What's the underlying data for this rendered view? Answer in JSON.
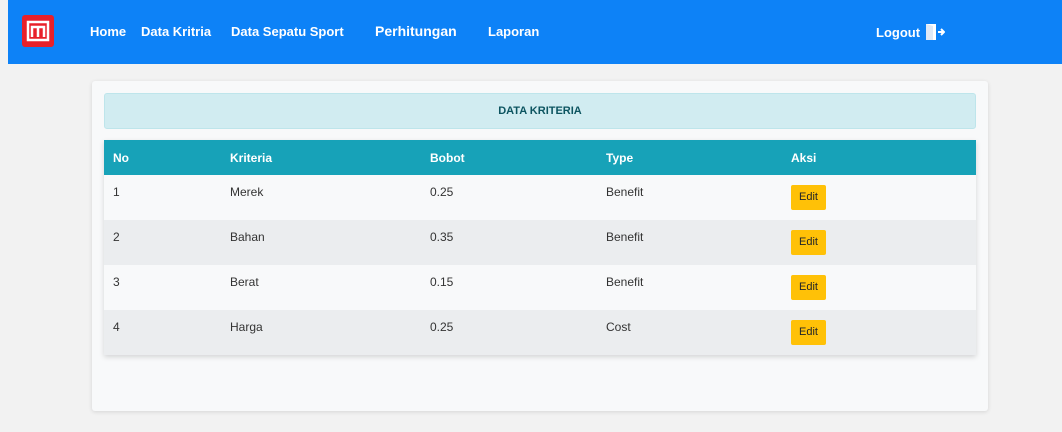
{
  "navbar": {
    "brand_icon": "app-logo-icon",
    "links": [
      "Home",
      "Data Kritria",
      "Data Sepatu Sport",
      "Perhitungan",
      "Laporan"
    ],
    "logout_label": "Logout",
    "logout_icon": "logout-door-icon",
    "bg_color": "#0d82f7"
  },
  "page": {
    "title": "DATA KRITERIA"
  },
  "table": {
    "headers": [
      "No",
      "Kriteria",
      "Bobot",
      "Type",
      "Aksi"
    ],
    "rows": [
      {
        "no": "1",
        "kriteria": "Merek",
        "bobot": "0.25",
        "type": "Benefit",
        "action": "Edit"
      },
      {
        "no": "2",
        "kriteria": "Bahan",
        "bobot": "0.35",
        "type": "Benefit",
        "action": "Edit"
      },
      {
        "no": "3",
        "kriteria": "Berat",
        "bobot": "0.15",
        "type": "Benefit",
        "action": "Edit"
      },
      {
        "no": "4",
        "kriteria": "Harga",
        "bobot": "0.25",
        "type": "Cost",
        "action": "Edit"
      }
    ],
    "header_color": "#17a2b8",
    "button_color": "#ffc107"
  }
}
